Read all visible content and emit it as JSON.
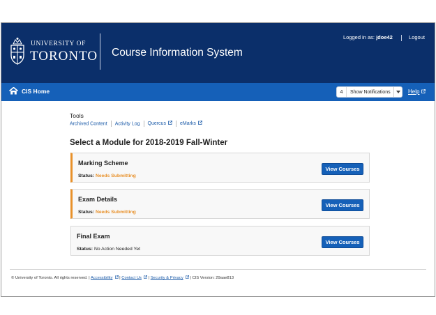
{
  "header": {
    "university_line1": "UNIVERSITY OF",
    "university_line2": "TORONTO",
    "app_title": "Course Information System",
    "logged_in_prefix": "Logged in as: ",
    "username": "jdoe42",
    "logout_label": "Logout"
  },
  "navbar": {
    "home_label": "CIS Home",
    "notification_count": "4",
    "notifications_label": "Show Notifications",
    "help_label": "Help"
  },
  "tools": {
    "title": "Tools",
    "links": [
      "Archived Content",
      "Activity Log",
      "Quercus",
      "eMarks"
    ]
  },
  "main": {
    "heading": "Select a Module for 2018-2019 Fall-Winter",
    "status_prefix": "Status:",
    "modules": [
      {
        "title": "Marking Scheme",
        "status": "Needs Submitting",
        "button": "View Courses"
      },
      {
        "title": "Exam Details",
        "status": "Needs Submitting",
        "button": "View Courses"
      },
      {
        "title": "Final Exam",
        "status": "No Action Needed Yet",
        "button": "View Courses"
      }
    ]
  },
  "footer": {
    "copyright": "© University of Toronto. All rights reserved.",
    "accessibility": "Accessibility",
    "contact": "Contact Us",
    "security": "Security & Privacy",
    "version": "CIS Version: 29aae813"
  },
  "colors": {
    "banner": "#0b2f6a",
    "navbar": "#1560b8",
    "warning": "#e8912a",
    "link": "#1a5aa8"
  },
  "icons": [
    "crest-icon",
    "home-icon",
    "caret-down-icon",
    "external-link-icon"
  ]
}
